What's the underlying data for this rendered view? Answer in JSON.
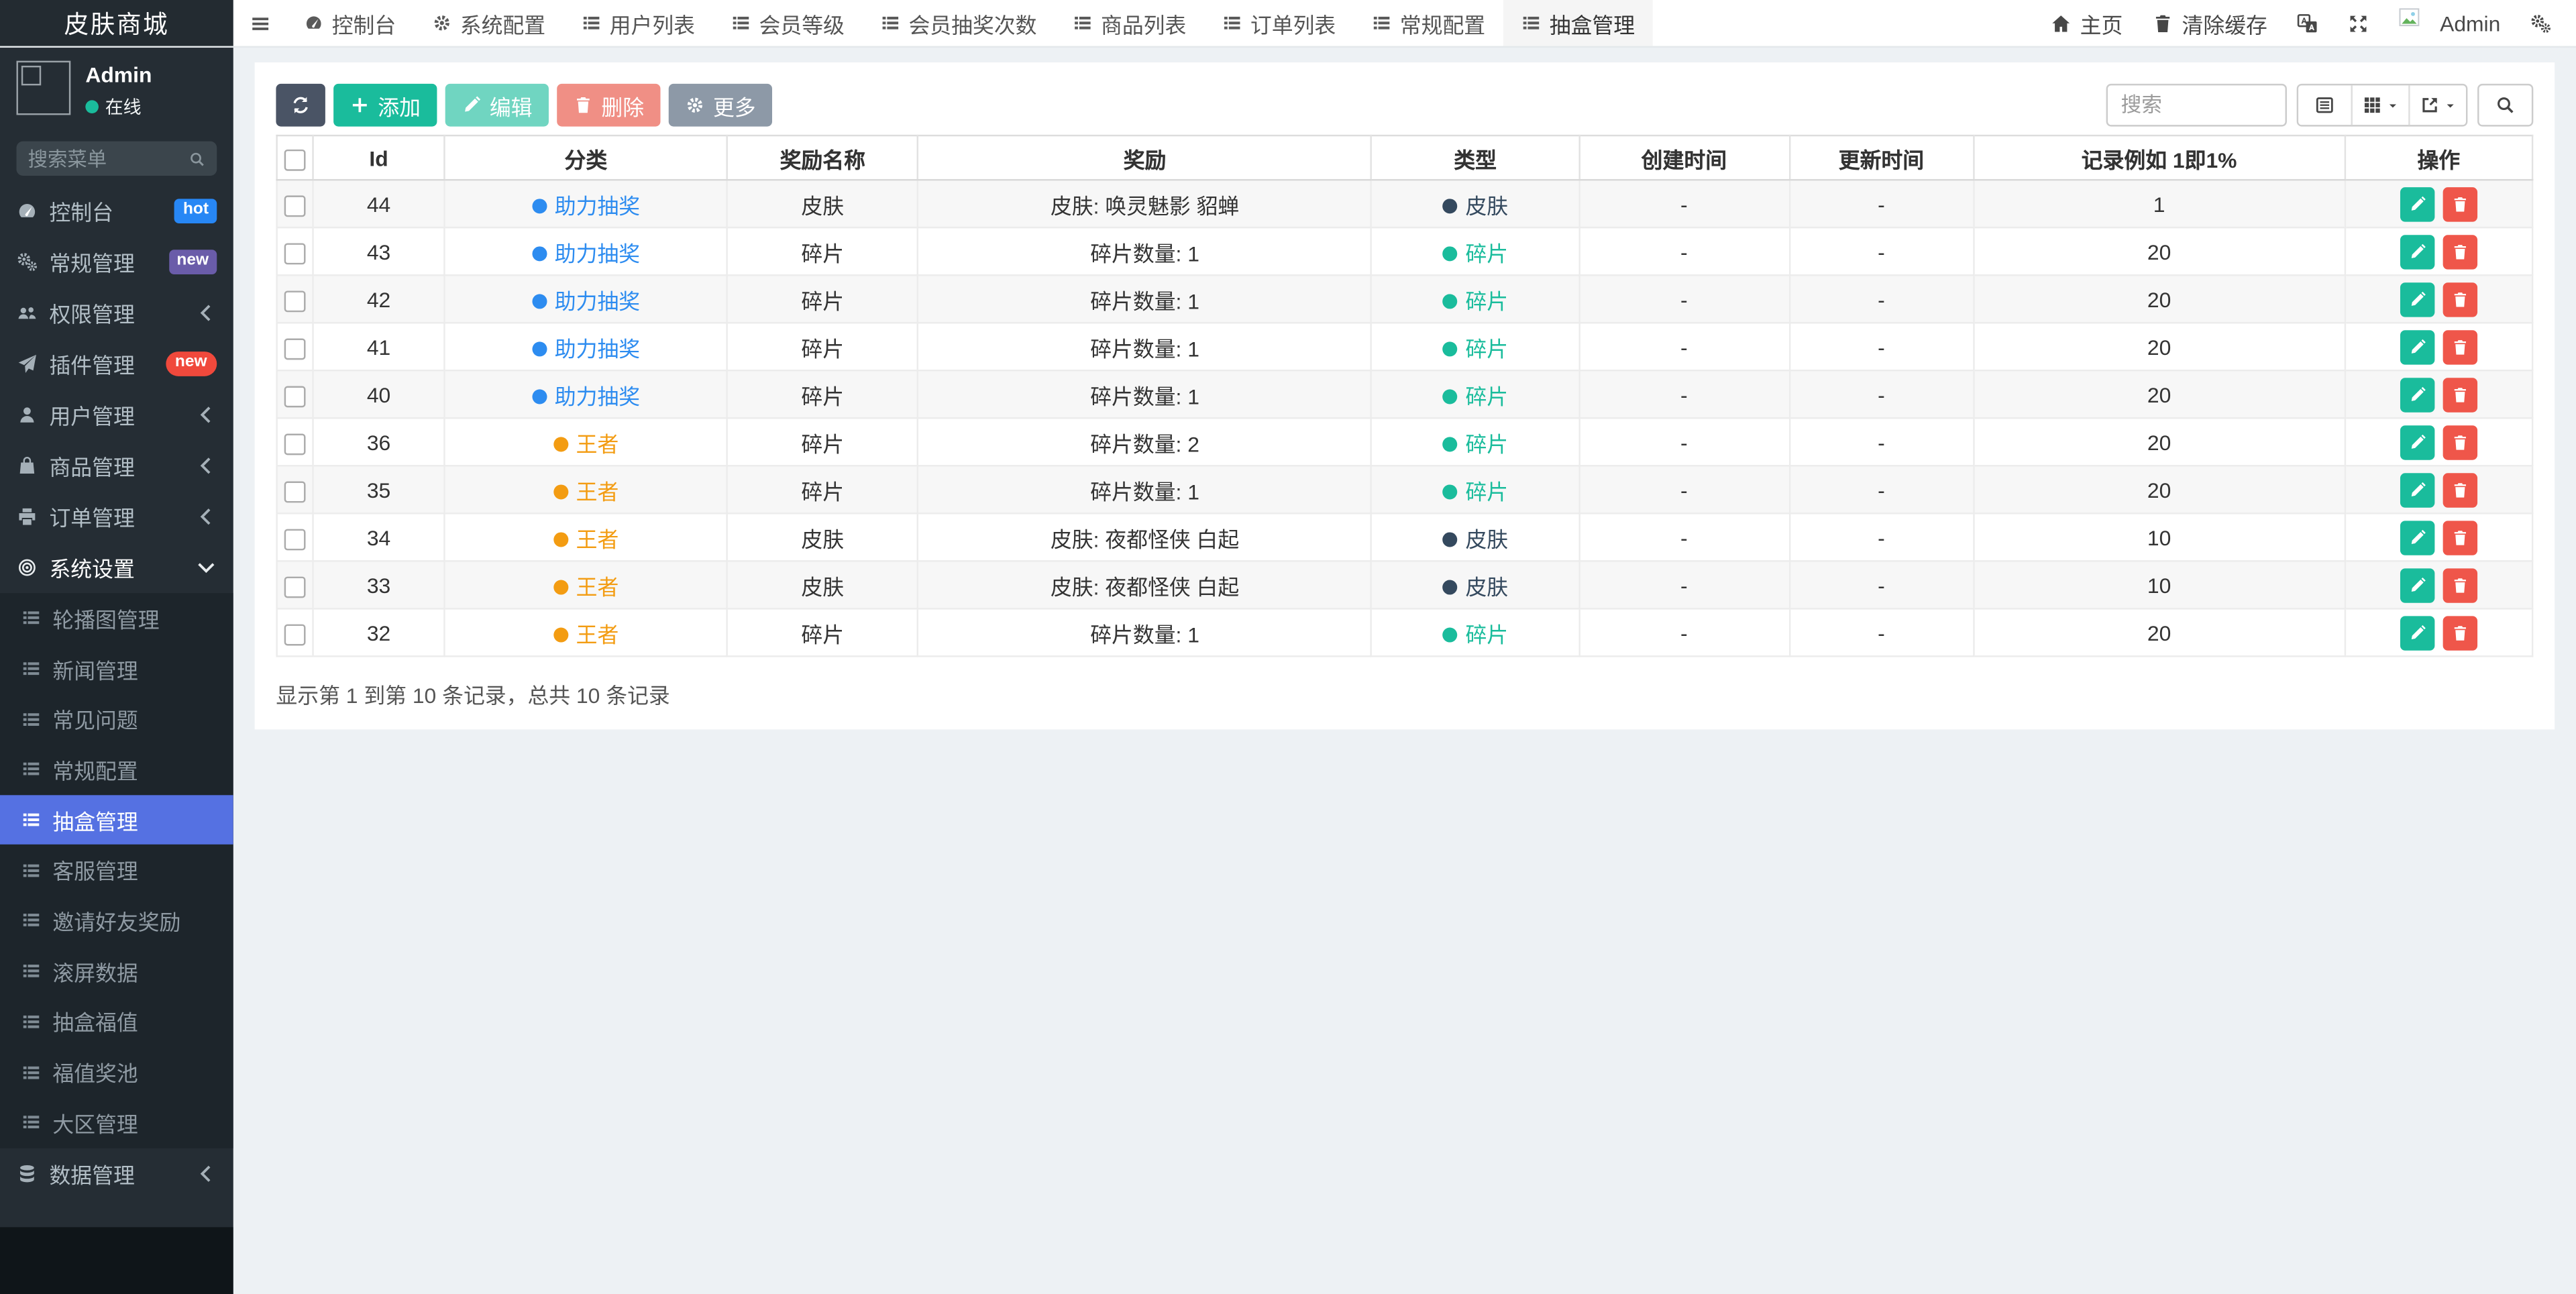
{
  "app": {
    "title": "皮肤商城"
  },
  "topbar": {
    "tabs": [
      {
        "label": "控制台",
        "icon": "dashboard-icon"
      },
      {
        "label": "系统配置",
        "icon": "gear-icon"
      },
      {
        "label": "用户列表",
        "icon": "list-icon"
      },
      {
        "label": "会员等级",
        "icon": "list-icon"
      },
      {
        "label": "会员抽奖次数",
        "icon": "list-icon"
      },
      {
        "label": "商品列表",
        "icon": "list-icon"
      },
      {
        "label": "订单列表",
        "icon": "list-icon"
      },
      {
        "label": "常规配置",
        "icon": "list-icon"
      },
      {
        "label": "抽盒管理",
        "icon": "list-icon",
        "active": true
      }
    ],
    "right_items": [
      {
        "name": "home",
        "label": "主页",
        "icon": "home-icon"
      },
      {
        "name": "clear-cache",
        "label": "清除缓存",
        "icon": "trash-icon"
      },
      {
        "name": "language",
        "icon": "translate-icon"
      },
      {
        "name": "fullscreen",
        "icon": "expand-icon"
      },
      {
        "name": "user",
        "label": "Admin",
        "icon": "avatar-icon"
      },
      {
        "name": "settings",
        "icon": "cogs-icon"
      }
    ]
  },
  "sidebar": {
    "user": {
      "name": "Admin",
      "status": "在线",
      "status_color": "#1abc9c"
    },
    "search_placeholder": "搜索菜单",
    "menu": [
      {
        "label": "控制台",
        "icon": "dashboard-icon",
        "badge": {
          "text": "hot",
          "color": "#2787f5",
          "shape": "rounded"
        }
      },
      {
        "label": "常规管理",
        "icon": "cogs-icon",
        "badge": {
          "text": "new",
          "color": "#6a5ca9",
          "shape": "rounded"
        }
      },
      {
        "label": "权限管理",
        "icon": "users-icon",
        "chevron": "left"
      },
      {
        "label": "插件管理",
        "icon": "rocket-icon",
        "badge": {
          "text": "new",
          "color": "#f0493c",
          "shape": "pill"
        }
      },
      {
        "label": "用户管理",
        "icon": "user-icon",
        "chevron": "left"
      },
      {
        "label": "商品管理",
        "icon": "bag-icon",
        "chevron": "left"
      },
      {
        "label": "订单管理",
        "icon": "printer-icon",
        "chevron": "left"
      },
      {
        "label": "系统设置",
        "icon": "bullseye-icon",
        "chevron": "down",
        "open": true,
        "children": [
          {
            "label": "轮播图管理"
          },
          {
            "label": "新闻管理"
          },
          {
            "label": "常见问题"
          },
          {
            "label": "常规配置"
          },
          {
            "label": "抽盒管理",
            "active": true
          },
          {
            "label": "客服管理"
          },
          {
            "label": "邀请好友奖励"
          },
          {
            "label": "滚屏数据"
          },
          {
            "label": "抽盒福值"
          },
          {
            "label": "福值奖池"
          },
          {
            "label": "大区管理"
          }
        ]
      },
      {
        "label": "数据管理",
        "icon": "database-icon",
        "chevron": "left"
      }
    ]
  },
  "toolbar": {
    "buttons": [
      {
        "name": "refresh",
        "icon": "refresh-icon",
        "color": "#4a5465"
      },
      {
        "name": "add",
        "label": "添加",
        "icon": "plus-icon",
        "color": "#1abc9c"
      },
      {
        "name": "edit",
        "label": "编辑",
        "icon": "pencil-icon",
        "color": "#1abc9c",
        "disabled": true
      },
      {
        "name": "delete",
        "label": "删除",
        "icon": "trash-icon",
        "color": "#e74c3c",
        "disabled": true
      },
      {
        "name": "more",
        "label": "更多",
        "icon": "gear-icon",
        "color": "#8d99a7"
      }
    ],
    "search_placeholder": "搜索",
    "view_buttons": [
      {
        "name": "detail-view",
        "icon": "table-view-icon"
      },
      {
        "name": "columns",
        "icon": "columns-icon",
        "caret": true
      },
      {
        "name": "export",
        "icon": "export-icon",
        "caret": true
      }
    ],
    "search_button_icon": "search-icon"
  },
  "table": {
    "columns": [
      "Id",
      "分类",
      "奖励名称",
      "奖励",
      "类型",
      "创建时间",
      "更新时间",
      "记录例如 1即1%",
      "操作"
    ],
    "rows": [
      {
        "id": "44",
        "category": "助力抽奖",
        "category_color": "#2d8cf0",
        "reward_name": "皮肤",
        "reward": "皮肤: 唤灵魅影 貂蝉",
        "type": "皮肤",
        "type_color": "#34495e",
        "created": "-",
        "updated": "-",
        "record": "1"
      },
      {
        "id": "43",
        "category": "助力抽奖",
        "category_color": "#2d8cf0",
        "reward_name": "碎片",
        "reward": "碎片数量: 1",
        "type": "碎片",
        "type_color": "#1abc9c",
        "created": "-",
        "updated": "-",
        "record": "20"
      },
      {
        "id": "42",
        "category": "助力抽奖",
        "category_color": "#2d8cf0",
        "reward_name": "碎片",
        "reward": "碎片数量: 1",
        "type": "碎片",
        "type_color": "#1abc9c",
        "created": "-",
        "updated": "-",
        "record": "20"
      },
      {
        "id": "41",
        "category": "助力抽奖",
        "category_color": "#2d8cf0",
        "reward_name": "碎片",
        "reward": "碎片数量: 1",
        "type": "碎片",
        "type_color": "#1abc9c",
        "created": "-",
        "updated": "-",
        "record": "20"
      },
      {
        "id": "40",
        "category": "助力抽奖",
        "category_color": "#2d8cf0",
        "reward_name": "碎片",
        "reward": "碎片数量: 1",
        "type": "碎片",
        "type_color": "#1abc9c",
        "created": "-",
        "updated": "-",
        "record": "20"
      },
      {
        "id": "36",
        "category": "王者",
        "category_color": "#f39c12",
        "reward_name": "碎片",
        "reward": "碎片数量: 2",
        "type": "碎片",
        "type_color": "#1abc9c",
        "created": "-",
        "updated": "-",
        "record": "20"
      },
      {
        "id": "35",
        "category": "王者",
        "category_color": "#f39c12",
        "reward_name": "碎片",
        "reward": "碎片数量: 1",
        "type": "碎片",
        "type_color": "#1abc9c",
        "created": "-",
        "updated": "-",
        "record": "20"
      },
      {
        "id": "34",
        "category": "王者",
        "category_color": "#f39c12",
        "reward_name": "皮肤",
        "reward": "皮肤: 夜都怪侠 白起",
        "type": "皮肤",
        "type_color": "#34495e",
        "created": "-",
        "updated": "-",
        "record": "10"
      },
      {
        "id": "33",
        "category": "王者",
        "category_color": "#f39c12",
        "reward_name": "皮肤",
        "reward": "皮肤: 夜都怪侠 白起",
        "type": "皮肤",
        "type_color": "#34495e",
        "created": "-",
        "updated": "-",
        "record": "10"
      },
      {
        "id": "32",
        "category": "王者",
        "category_color": "#f39c12",
        "reward_name": "碎片",
        "reward": "碎片数量: 1",
        "type": "碎片",
        "type_color": "#1abc9c",
        "created": "-",
        "updated": "-",
        "record": "20"
      }
    ],
    "footer": "显示第 1 到第 10 条记录，总共 10 条记录"
  },
  "colors": {
    "active_menu": "#5571e2",
    "link_blue": "#2d8cf0",
    "orange": "#f39c12",
    "teal": "#1abc9c",
    "navy": "#34495e",
    "edit_button": "#1abc9c",
    "delete_button": "#ef564a"
  }
}
